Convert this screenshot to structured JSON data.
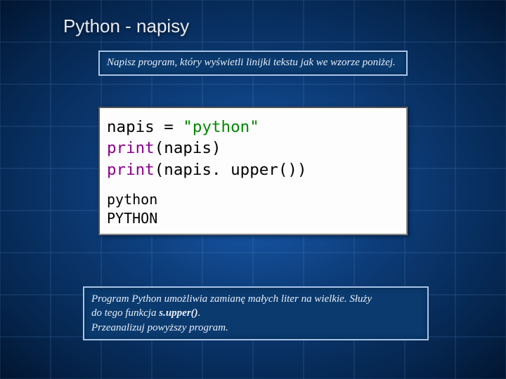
{
  "title": "Python - napisy",
  "instruction": "Napisz program, który wyświetli linijki tekstu jak we wzorze poniżej.",
  "code": {
    "line1": {
      "var": "napis",
      "assign": " = ",
      "str": "\"python\""
    },
    "line2": {
      "func": "print",
      "open": "(",
      "arg": "napis",
      "close": ")"
    },
    "line3": {
      "func": "print",
      "open": "(",
      "obj": "napis",
      "dot": ". ",
      "method": "upper",
      "parens": "()",
      "close": ")"
    }
  },
  "output": {
    "line1": "python",
    "line2": "PYTHON"
  },
  "bottom": {
    "l1a": "Program Python umożliwia zamianę małych liter na wielkie. Służy",
    "l2a": "do tego funkcja ",
    "l2b": "s.upper()",
    "l2c": ".",
    "l3": "Przeanalizuj powyższy program."
  }
}
